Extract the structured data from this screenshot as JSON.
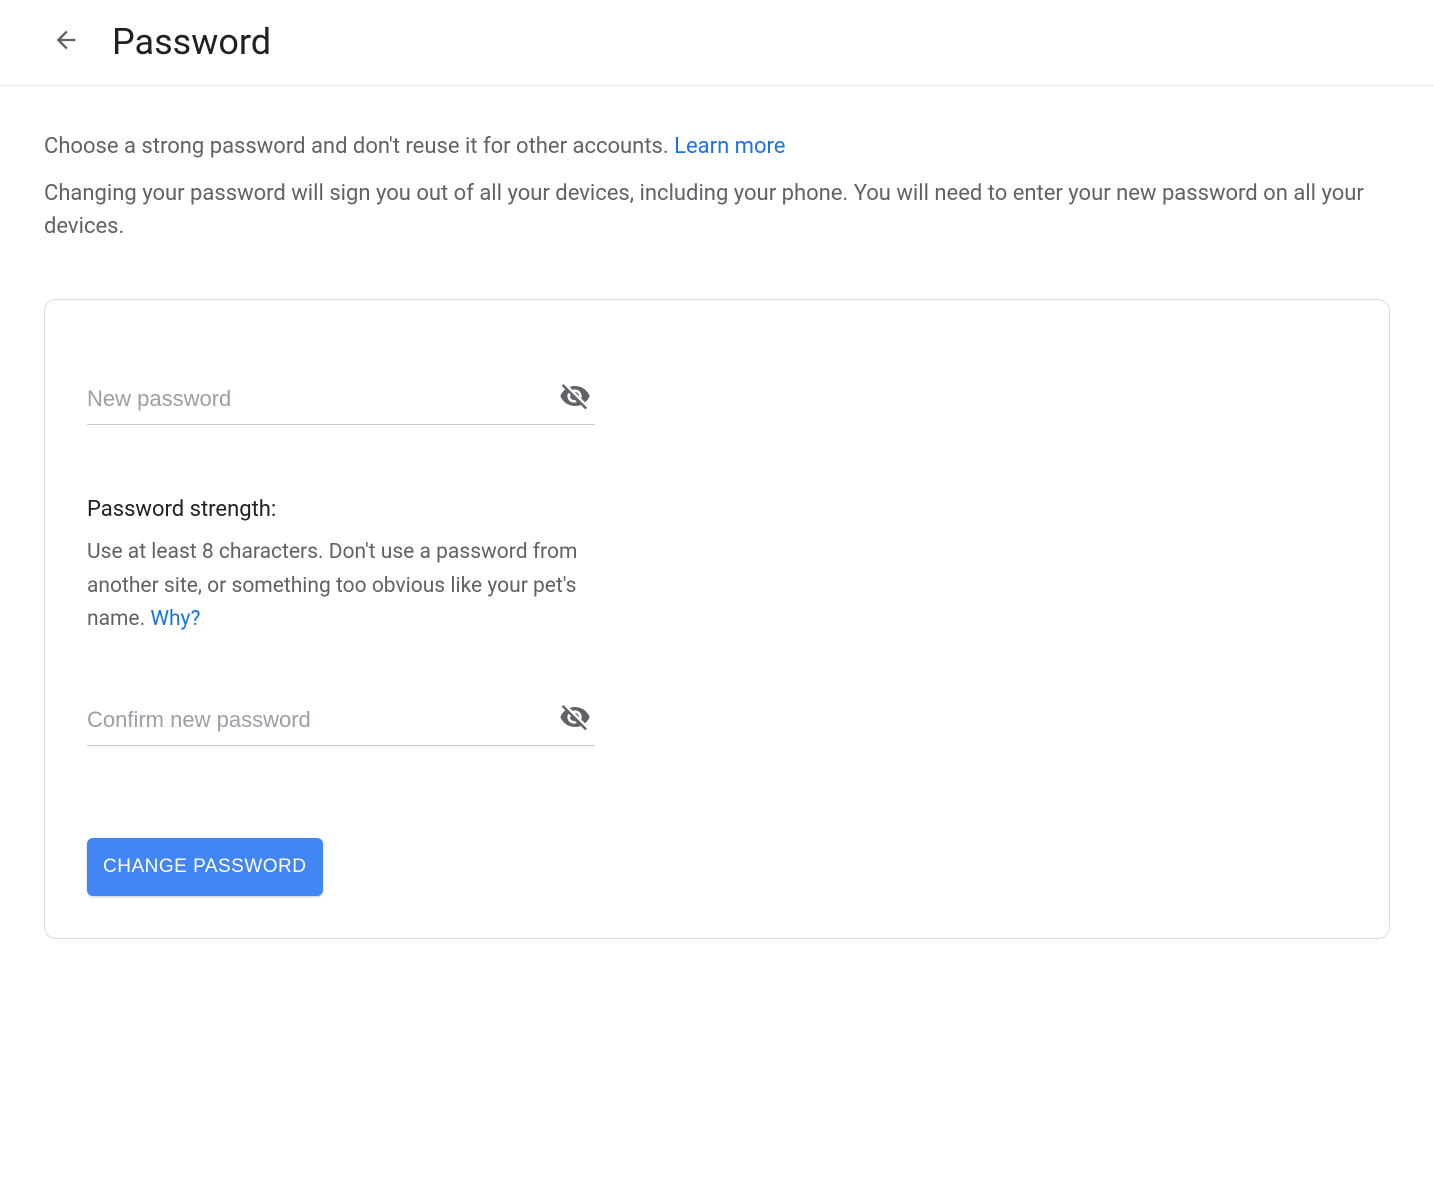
{
  "header": {
    "title": "Password"
  },
  "intro": {
    "line1_prefix": "Choose a strong password and don't reuse it for other accounts. ",
    "learn_more": "Learn more",
    "line2": "Changing your password will sign you out of all your devices, including your phone. You will need to enter your new password on all your devices."
  },
  "form": {
    "new_password_placeholder": "New password",
    "new_password_value": "",
    "confirm_password_placeholder": "Confirm new password",
    "confirm_password_value": "",
    "strength_label": "Password strength:",
    "strength_hint_prefix": "Use at least 8 characters. Don't use a password from another site, or something too obvious like your pet's name. ",
    "why_link": "Why?",
    "submit_label": "CHANGE PASSWORD"
  }
}
